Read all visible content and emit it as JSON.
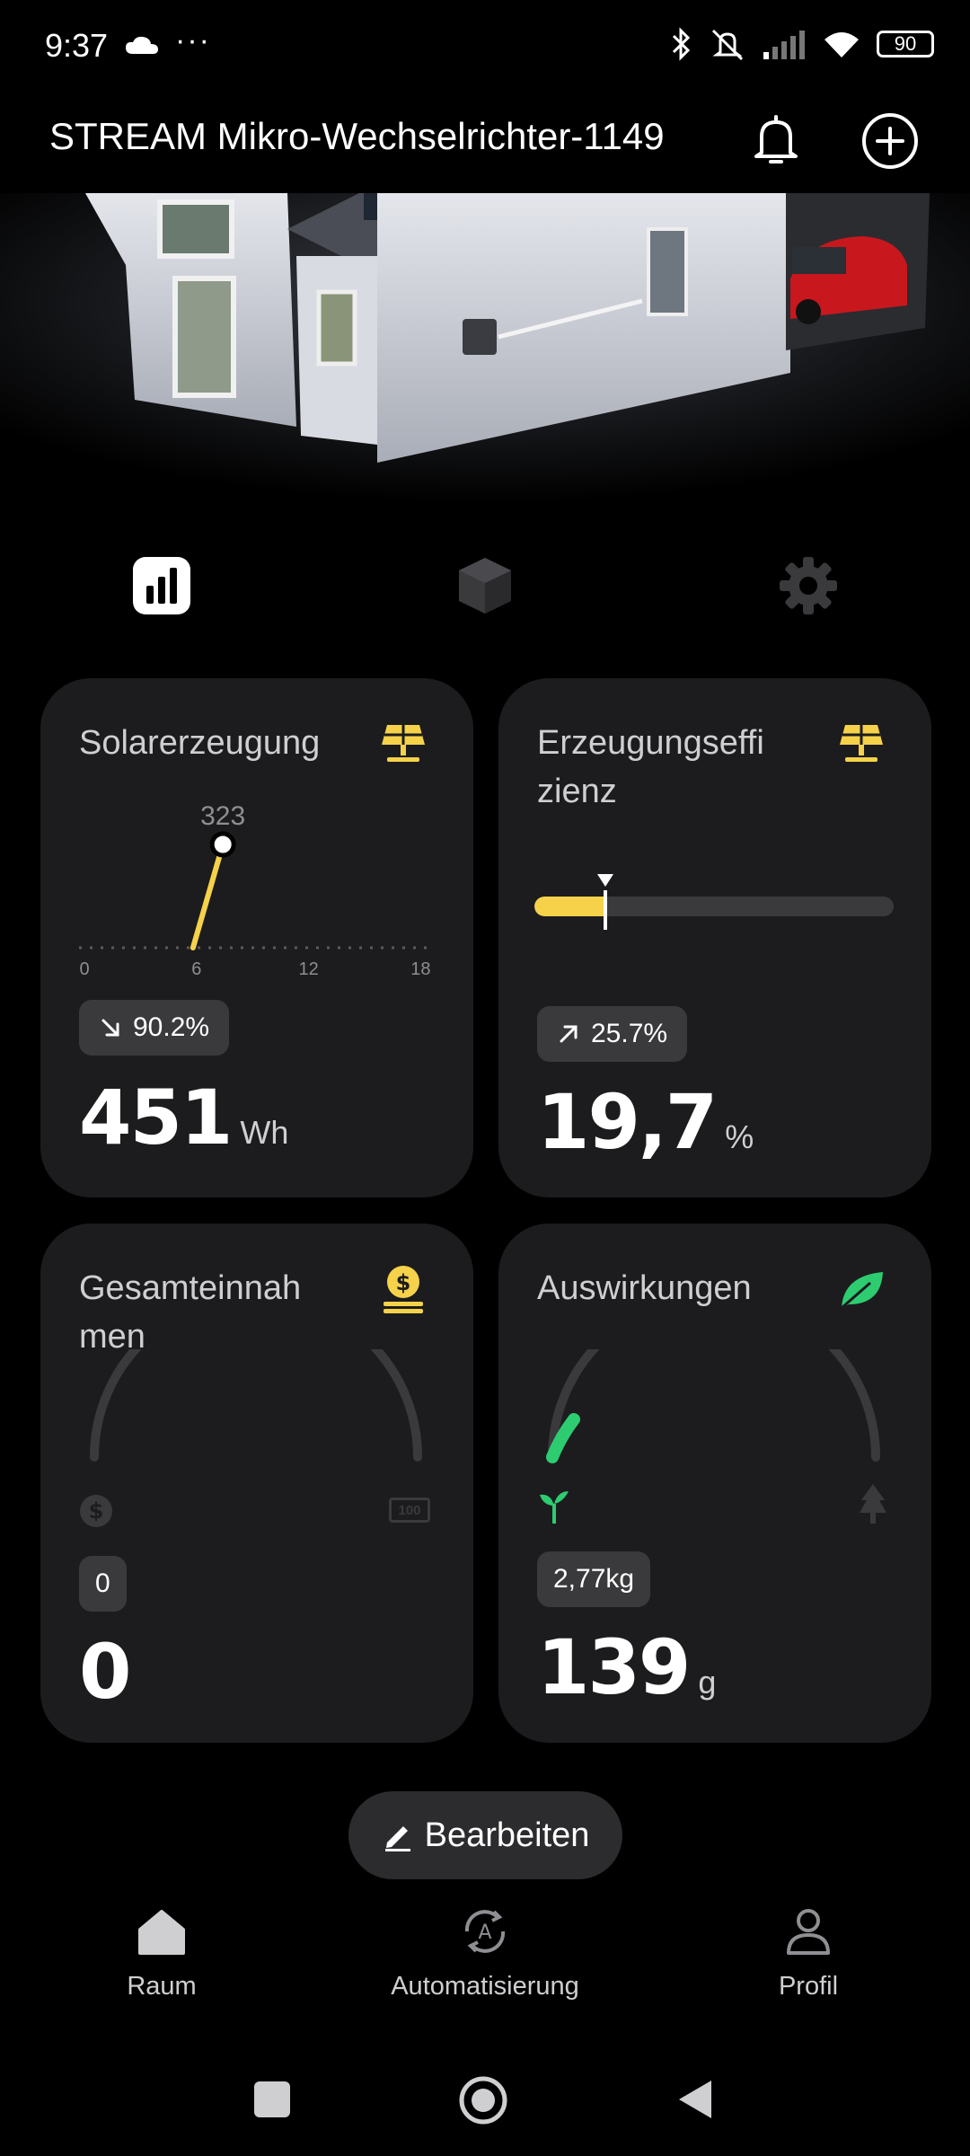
{
  "status_bar": {
    "time": "9:37",
    "battery": "90"
  },
  "header": {
    "title": "STREAM Mikro-Wechselrichter-1149"
  },
  "cards": {
    "solar": {
      "title": "Solarerzeugung",
      "chart_data": {
        "type": "line",
        "x": [
          6.1,
          7.7
        ],
        "values": [
          0,
          323
        ],
        "peak_label": "323",
        "x_ticks": [
          "0",
          "6",
          "12",
          "18"
        ],
        "xlim": [
          0,
          24
        ]
      },
      "badge": "90.2%",
      "value": "451",
      "unit": "Wh"
    },
    "efficiency": {
      "title": "Erzeugungseffi zienz",
      "level_percent": 19.7,
      "badge": "25.7%",
      "value": "19,7",
      "unit": "%"
    },
    "income": {
      "title": "Gesamteinnah men",
      "badge": "0",
      "value": "0",
      "gauge_max_label": "100"
    },
    "impact": {
      "title": "Auswirkungen",
      "badge": "2,77kg",
      "value": "139",
      "unit": "g"
    }
  },
  "edit_button": {
    "label": "Bearbeiten"
  },
  "bottom_nav": {
    "items": [
      {
        "label": "Raum"
      },
      {
        "label": "Automatisierung"
      },
      {
        "label": "Profil"
      }
    ]
  },
  "colors": {
    "accent_yellow": "#f5d24a",
    "accent_green": "#2ecc71",
    "card_bg": "#1c1c1e"
  }
}
